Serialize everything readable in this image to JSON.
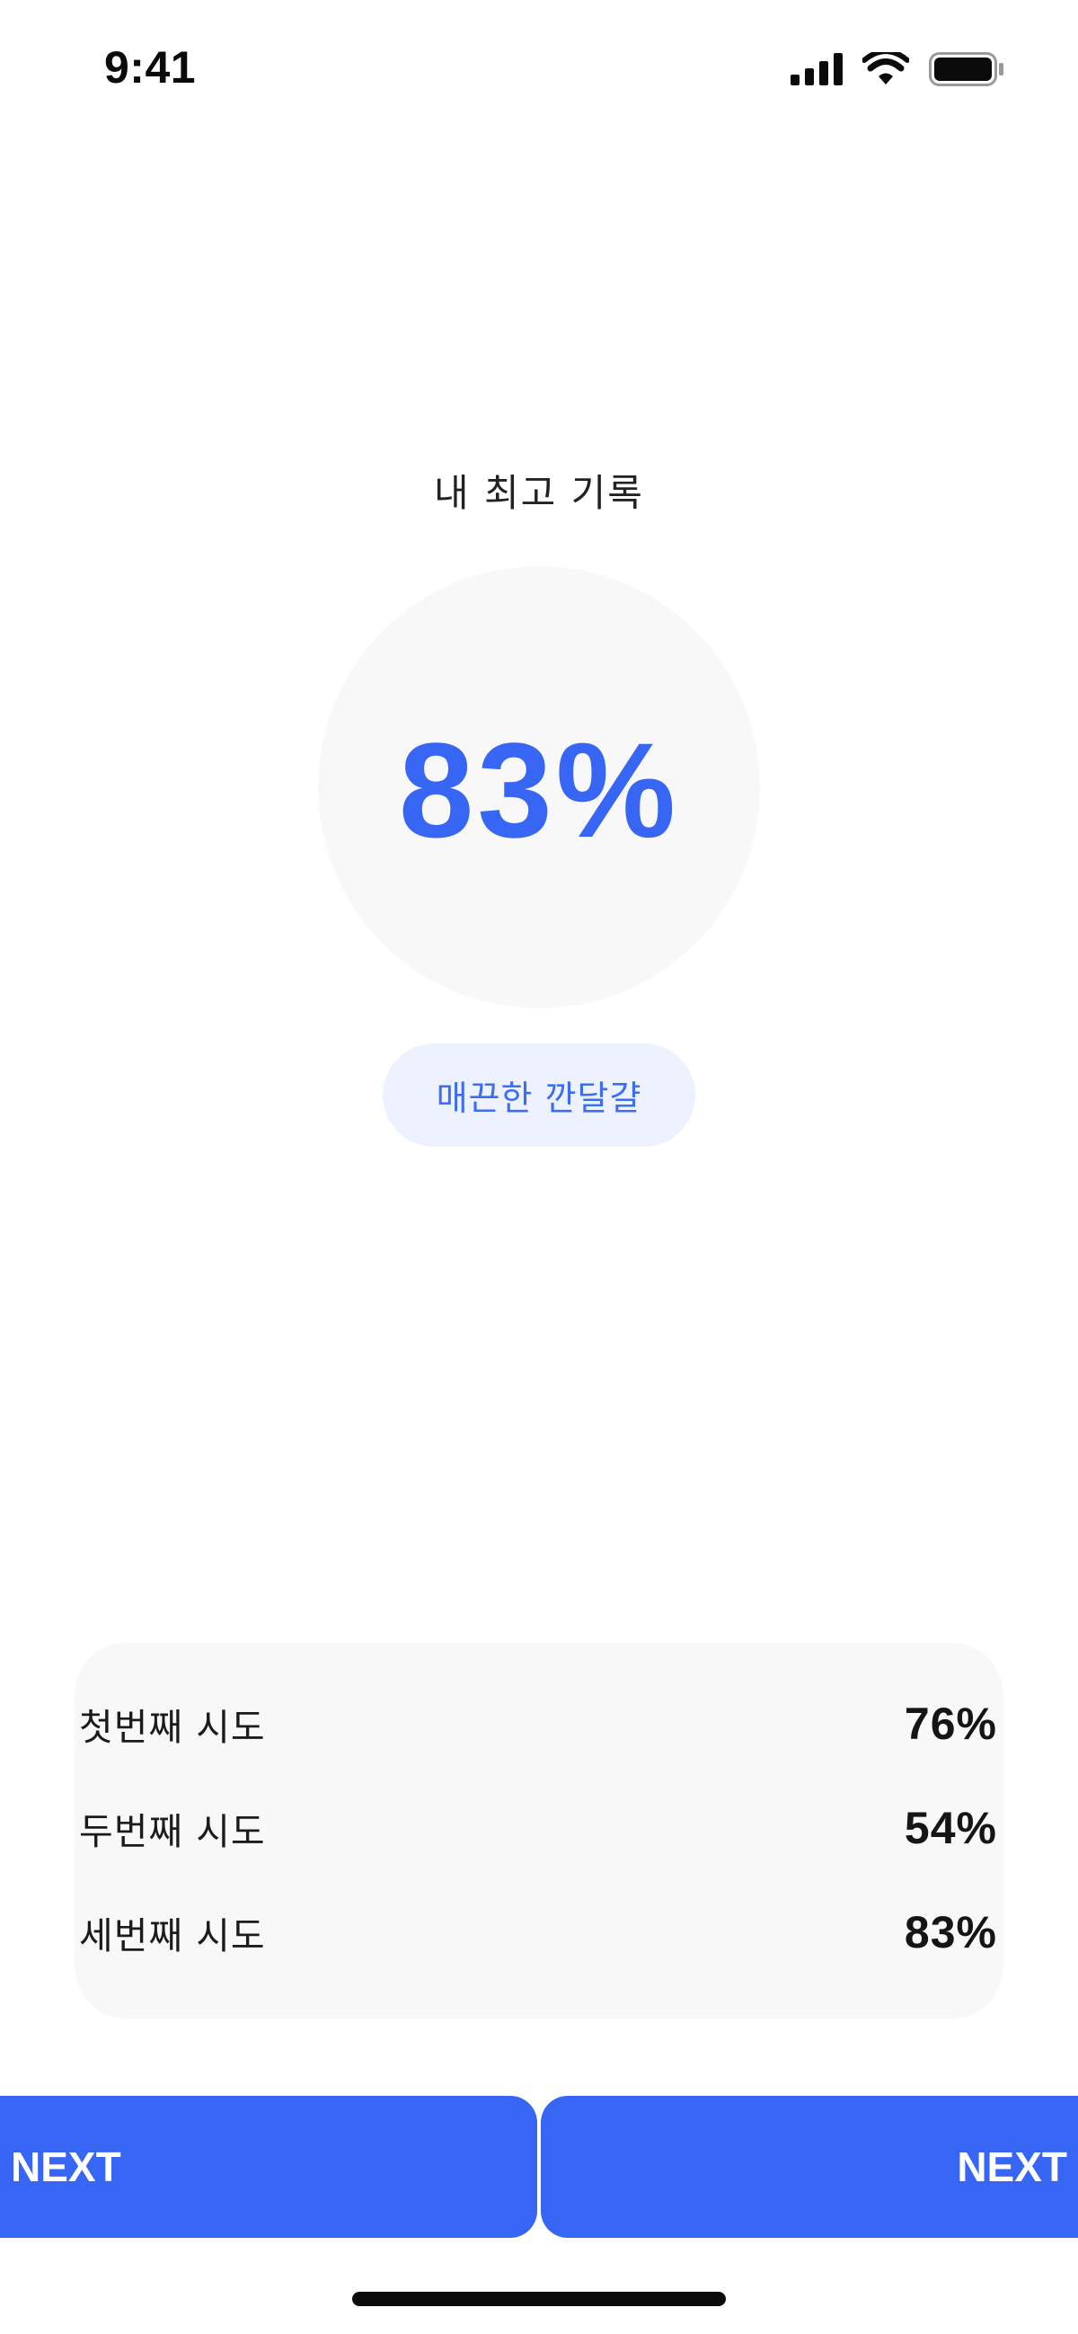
{
  "status_bar": {
    "time": "9:41"
  },
  "result": {
    "title": "내 최고 기록",
    "best_score": "83%",
    "grade_badge": "매끈한 깐달걀"
  },
  "attempts": [
    {
      "label": "첫번째 시도",
      "score": "76%"
    },
    {
      "label": "두번째 시도",
      "score": "54%"
    },
    {
      "label": "세번째 시도",
      "score": "83%"
    }
  ],
  "buttons": {
    "left_next": "NEXT",
    "right_next": "NEXT"
  },
  "colors": {
    "accent": "#3766f4",
    "badge_bg": "#edf2fe",
    "card_bg": "#f8f8f9"
  },
  "icons": {
    "signal": "cellular-signal-icon",
    "wifi": "wifi-icon",
    "battery": "battery-icon"
  }
}
